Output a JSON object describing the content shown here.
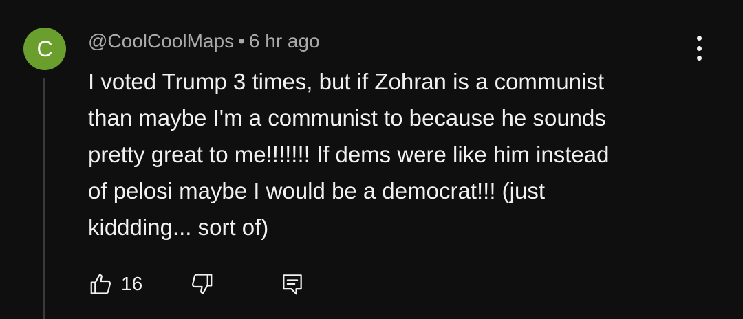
{
  "comment": {
    "avatar_letter": "C",
    "avatar_color": "#6a9f2e",
    "author": "@CoolCoolMaps",
    "separator": "•",
    "timestamp": "6 hr ago",
    "text_lines": [
      "I voted Trump 3 times, but if Zohran is a communist",
      "than maybe I'm a communist to because he sounds",
      "pretty great to me!!!!!!! If dems were like him instead",
      "of pelosi maybe I would be a democrat!!! (just",
      "kiddding... sort of)"
    ],
    "like_count": "16",
    "icons": {
      "like": "thumbs-up-icon",
      "dislike": "thumbs-down-icon",
      "reply": "reply-comment-icon",
      "menu": "more-vertical-icon"
    }
  }
}
